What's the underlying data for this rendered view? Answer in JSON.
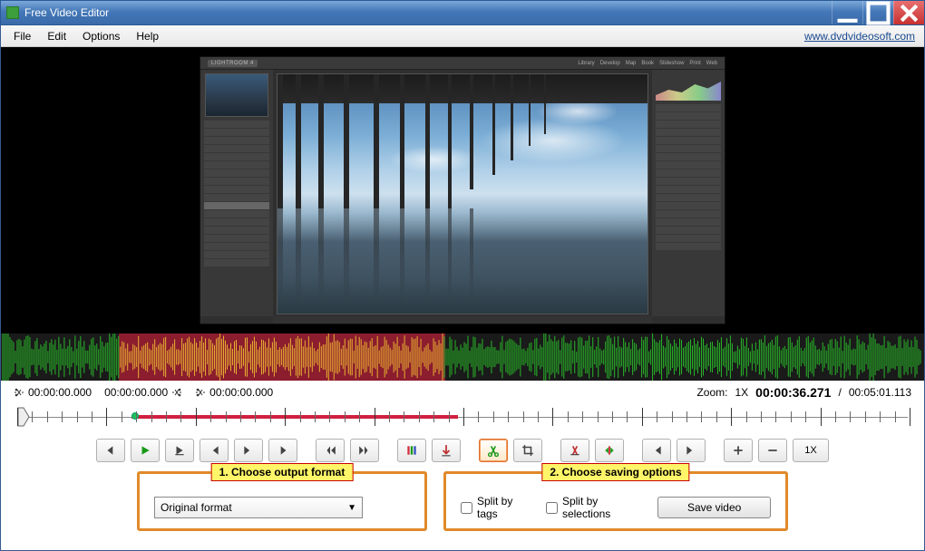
{
  "window": {
    "title": "Free Video Editor"
  },
  "menu": {
    "file": "File",
    "edit": "Edit",
    "options": "Options",
    "help": "Help",
    "link": "www.dvdvideosoft.com"
  },
  "preview": {
    "product_label": "LIGHTROOM 4",
    "top_tabs": [
      "Library",
      "Develop",
      "Map",
      "Book",
      "Slideshow",
      "Print",
      "Web"
    ]
  },
  "timecodes": {
    "open_start": "00:00:00.000",
    "open_end": "00:00:00.000",
    "close_start": "00:00:00.000",
    "zoom_label": "Zoom:",
    "zoom_value": "1X",
    "current": "00:00:36.271",
    "sep": "/",
    "total": "00:05:01.113"
  },
  "toolbar": {
    "zoom_reset": "1X"
  },
  "annotations": {
    "step1": "1. Choose output format",
    "step2": "2. Choose saving options"
  },
  "output": {
    "format_selected": "Original format",
    "split_by_tags": "Split by tags",
    "split_by_selections": "Split by selections",
    "save_button": "Save video"
  },
  "colors": {
    "accent_orange": "#e08a2a",
    "highlight_yellow": "#fff568",
    "selection_red": "#d02040"
  }
}
